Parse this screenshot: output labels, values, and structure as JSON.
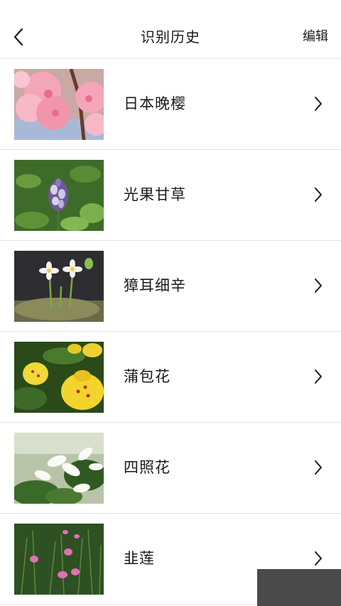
{
  "header": {
    "title": "识别历史",
    "edit_label": "编辑",
    "back_icon": "chevron-left-icon"
  },
  "items": [
    {
      "label": "日本晚樱",
      "thumb": "cherry-blossom"
    },
    {
      "label": "光果甘草",
      "thumb": "licorice"
    },
    {
      "label": "獐耳细辛",
      "thumb": "hepatica"
    },
    {
      "label": "蒲包花",
      "thumb": "calceolaria"
    },
    {
      "label": "四照花",
      "thumb": "dogwood"
    },
    {
      "label": "韭莲",
      "thumb": "rain-lily"
    }
  ],
  "colors": {
    "background": "#ffffff",
    "divider": "#e4e4e8",
    "text": "#1a1a1a"
  }
}
